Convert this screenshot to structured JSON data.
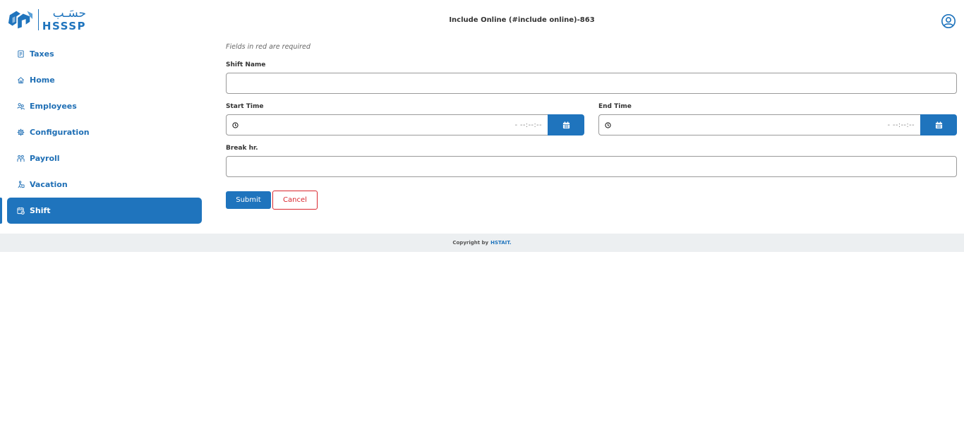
{
  "header": {
    "logo_arabic": "حسَـب",
    "logo_english": "HSSSP",
    "page_title": "Include Online (#include online)-863",
    "profile_icon": "user-circle-icon"
  },
  "sidebar": {
    "items": [
      {
        "label": "Taxes",
        "icon": "receipt-icon"
      },
      {
        "label": "Home",
        "icon": "home-icon"
      },
      {
        "label": "Employees",
        "icon": "users-icon"
      },
      {
        "label": "Configuration",
        "icon": "gear-icon"
      },
      {
        "label": "Payroll",
        "icon": "payroll-icon"
      },
      {
        "label": "Vacation",
        "icon": "vacation-icon"
      },
      {
        "label": "Shift",
        "icon": "shift-calendar-icon",
        "active": true
      }
    ]
  },
  "form": {
    "hint": "Fields in red are required",
    "shift_name": {
      "label": "Shift Name",
      "value": ""
    },
    "start_time": {
      "label": "Start Time",
      "placeholder": "- --:--:--"
    },
    "end_time": {
      "label": "End Time",
      "placeholder": "- --:--:--"
    },
    "break_hr": {
      "label": "Break hr.",
      "value": ""
    },
    "submit_label": "Submit",
    "cancel_label": "Cancel"
  },
  "footer": {
    "copyright": "Copyright by",
    "brand": "HSTAIT."
  },
  "colors": {
    "primary": "#1f74bd",
    "danger": "#d9272e",
    "footer_bg": "#eceff1"
  }
}
